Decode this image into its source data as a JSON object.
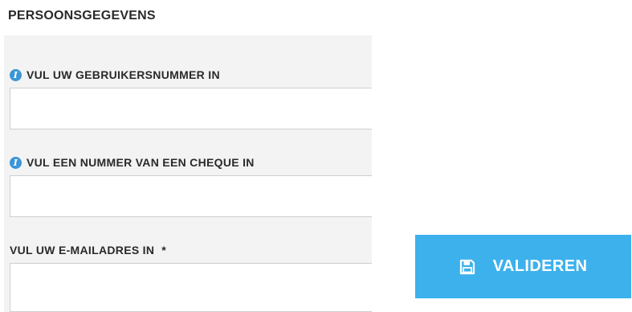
{
  "section": {
    "title": "PERSOONSGEGEVENS"
  },
  "fields": [
    {
      "label": "VUL UW GEBRUIKERSNUMMER IN",
      "icon": "info-icon",
      "value": "",
      "placeholder": ""
    },
    {
      "label": "VUL EEN NUMMER VAN EEN CHEQUE IN",
      "icon": "info-icon",
      "value": "",
      "placeholder": ""
    },
    {
      "label": "VUL UW E-MAILADRES IN",
      "required_marker": "*",
      "value": "",
      "placeholder": ""
    }
  ],
  "submit": {
    "label": "VALIDEREN",
    "icon": "save-icon"
  },
  "colors": {
    "accent": "#3db1ec",
    "info": "#3b95d6",
    "panel": "#f3f3f3",
    "text": "#2a2a2a"
  }
}
